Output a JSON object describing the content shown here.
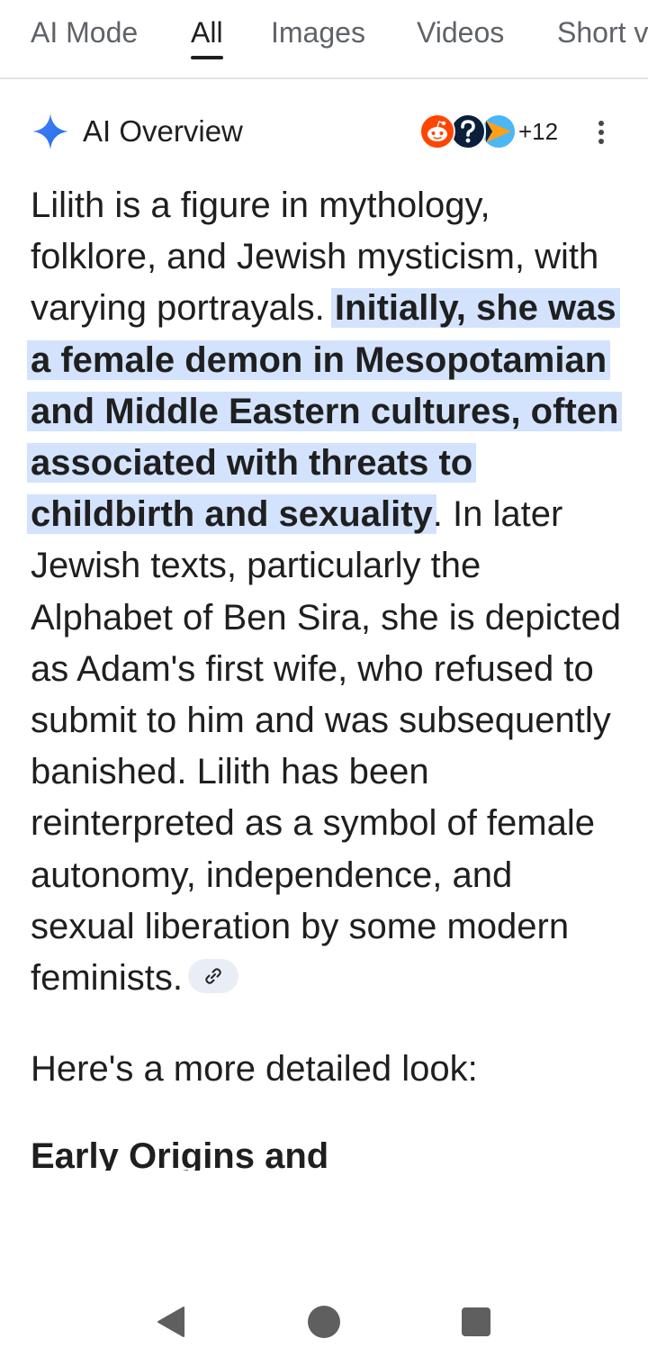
{
  "tabs": [
    {
      "label": "AI Mode",
      "active": false
    },
    {
      "label": "All",
      "active": true
    },
    {
      "label": "Images",
      "active": false
    },
    {
      "label": "Videos",
      "active": false
    },
    {
      "label": "Short v",
      "active": false
    }
  ],
  "overview": {
    "title": "AI Overview",
    "icon": "sparkle-icon",
    "sources_more": "+12",
    "source_icons": [
      "reddit-icon",
      "question-mark-icon",
      "play-arrow-icon"
    ]
  },
  "body": {
    "intro": "Lilith is a figure in mythology, folklore, and Jewish mysticism, with varying portrayals. ",
    "highlight": "Initially, she was a female demon in Mesopotamian and Middle Eastern cultures, often associated with threats to childbirth and sexuality",
    "rest": ". In later Jewish texts, particularly the Alphabet of Ben Sira, she is depicted as Adam's first wife, who refused to submit to him and was subsequently banished. Lilith has been reinterpreted as a symbol of female autonomy, independence, and sexual liberation by some modern feminists.",
    "detail": "Here's a more detailed look:",
    "heading": "Early Origins and"
  },
  "colors": {
    "highlight": "#d3e3fd",
    "text": "#1f1f1f",
    "muted": "#5f6368",
    "chip": "#e9eef6"
  },
  "navbar": {
    "icons": [
      "back-icon",
      "home-icon",
      "recents-icon"
    ]
  }
}
